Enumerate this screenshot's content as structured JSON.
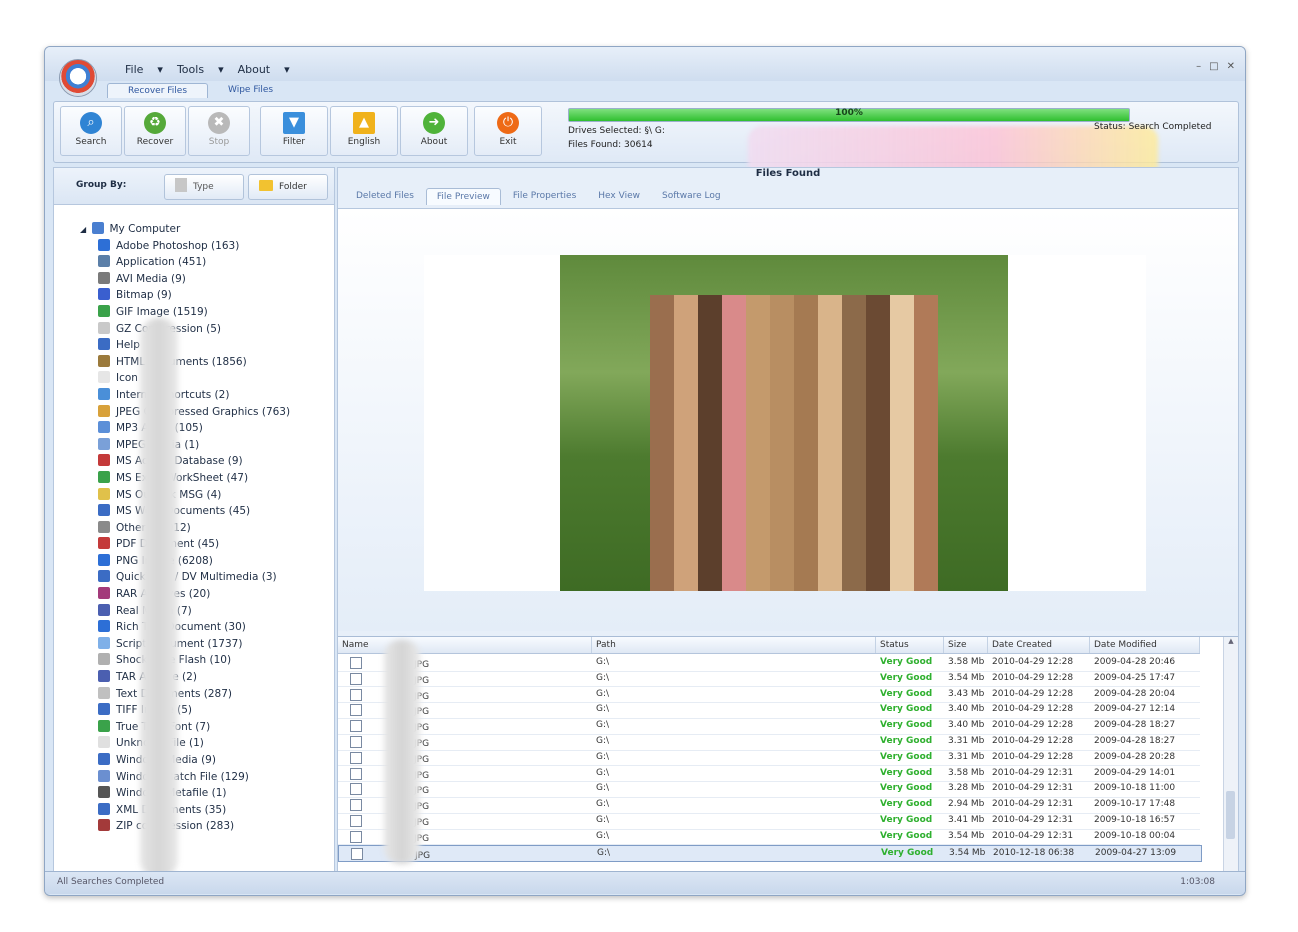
{
  "menu": {
    "file": "File",
    "tools": "Tools",
    "about": "About"
  },
  "app_tabs": [
    "Recover Files",
    "Wipe Files"
  ],
  "ribbon": {
    "buttons": [
      {
        "label": "Search",
        "icon": "search-icon"
      },
      {
        "label": "Recover",
        "icon": "recover-icon"
      },
      {
        "label": "Stop",
        "icon": "stop-icon"
      },
      {
        "label": "Filter",
        "icon": "filter-icon"
      },
      {
        "label": "English",
        "icon": "language-icon"
      },
      {
        "label": "About",
        "icon": "about-icon"
      },
      {
        "label": "Exit",
        "icon": "exit-icon"
      }
    ],
    "progress_percent": 100,
    "progress_label": "100%",
    "drive_selected": "Drives Selected: §\\ G:",
    "files_found": "Files Found: 30614",
    "status": "Status: Search Completed"
  },
  "group_by": {
    "label": "Group By:",
    "type_label": "Type",
    "folder_label": "Folder"
  },
  "tree": {
    "root": "My Computer",
    "items": [
      "Adobe Photoshop (163)",
      "Application (451)",
      "AVI Media (9)",
      "Bitmap (9)",
      "GIF Image (1519)",
      "GZ Compression (5)",
      "Help",
      "HTML Documents (1856)",
      "Icon",
      "Internet Shortcuts (2)",
      "JPEG Compressed Graphics (763)",
      "MP3 Audio (105)",
      "MPEG Media (1)",
      "MS Access Database (9)",
      "MS Excel WorkSheet (47)",
      "MS Outlook MSG (4)",
      "MS Word Documents (45)",
      "Other (13012)",
      "PDF Document (45)",
      "PNG Image (6208)",
      "QuickTime / DV Multimedia (3)",
      "RAR Archives (20)",
      "Real Media (7)",
      "Rich Text Document (30)",
      "Script Document (1737)",
      "Shockwave Flash (10)",
      "TAR Archive (2)",
      "Text Documents (287)",
      "TIFF Image (5)",
      "True Type Font (7)",
      "Unknown File (1)",
      "Windows Media (9)",
      "Windows Batch File (129)",
      "Windows Metafile (1)",
      "XML Documents (35)",
      "ZIP compression (283)"
    ]
  },
  "panel_title": "Files Found",
  "panel_tabs": [
    "Deleted Files",
    "File Preview",
    "File Properties",
    "Hex View",
    "Software Log"
  ],
  "grid": {
    "columns": [
      "Name",
      "Path",
      "Status",
      "Size",
      "Date Created",
      "Date Modified"
    ],
    "rows": [
      {
        "name": "JPG",
        "path": "G:\\",
        "status": "Very Good",
        "size": "3.58 Mb",
        "created": "2010-04-29 12:28",
        "modified": "2009-04-28 20:46"
      },
      {
        "name": "JPG",
        "path": "G:\\",
        "status": "Very Good",
        "size": "3.54 Mb",
        "created": "2010-04-29 12:28",
        "modified": "2009-04-25 17:47"
      },
      {
        "name": "JPG",
        "path": "G:\\",
        "status": "Very Good",
        "size": "3.43 Mb",
        "created": "2010-04-29 12:28",
        "modified": "2009-04-28 20:04"
      },
      {
        "name": "JPG",
        "path": "G:\\",
        "status": "Very Good",
        "size": "3.40 Mb",
        "created": "2010-04-29 12:28",
        "modified": "2009-04-27 12:14"
      },
      {
        "name": "JPG",
        "path": "G:\\",
        "status": "Very Good",
        "size": "3.40 Mb",
        "created": "2010-04-29 12:28",
        "modified": "2009-04-28 18:27"
      },
      {
        "name": "JPG",
        "path": "G:\\",
        "status": "Very Good",
        "size": "3.31 Mb",
        "created": "2010-04-29 12:28",
        "modified": "2009-04-28 18:27"
      },
      {
        "name": "JPG",
        "path": "G:\\",
        "status": "Very Good",
        "size": "3.31 Mb",
        "created": "2010-04-29 12:28",
        "modified": "2009-04-28 20:28"
      },
      {
        "name": "JPG",
        "path": "G:\\",
        "status": "Very Good",
        "size": "3.58 Mb",
        "created": "2010-04-29 12:31",
        "modified": "2009-04-29 14:01"
      },
      {
        "name": "JPG",
        "path": "G:\\",
        "status": "Very Good",
        "size": "3.28 Mb",
        "created": "2010-04-29 12:31",
        "modified": "2009-10-18 11:00"
      },
      {
        "name": "JPG",
        "path": "G:\\",
        "status": "Very Good",
        "size": "2.94 Mb",
        "created": "2010-04-29 12:31",
        "modified": "2009-10-17 17:48"
      },
      {
        "name": "JPG",
        "path": "G:\\",
        "status": "Very Good",
        "size": "3.41 Mb",
        "created": "2010-04-29 12:31",
        "modified": "2009-10-18 16:57"
      },
      {
        "name": "JPG",
        "path": "G:\\",
        "status": "Very Good",
        "size": "3.54 Mb",
        "created": "2010-04-29 12:31",
        "modified": "2009-10-18 00:04"
      },
      {
        "name": "JPG",
        "path": "G:\\",
        "status": "Very Good",
        "size": "3.54 Mb",
        "created": "2010-12-18 06:38",
        "modified": "2009-04-27 13:09"
      }
    ]
  },
  "statusbar": {
    "left": "All Searches Completed",
    "right": "1:03:08"
  },
  "colors": {
    "progress": "#2fbf2f",
    "status_good": "#2fb02f",
    "accent": "#3058a0"
  }
}
